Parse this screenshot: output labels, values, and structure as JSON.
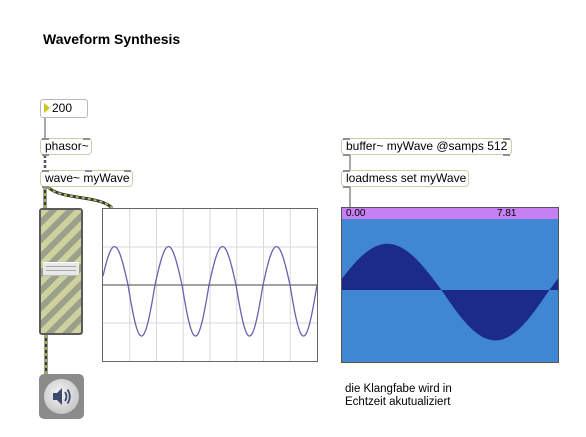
{
  "patch": {
    "title": "Waveform Synthesis",
    "number_box": {
      "value": "200"
    },
    "objects": {
      "phasor": "phasor~",
      "wave": "wave~ myWave",
      "buffer": "buffer~ myWave @samps 512",
      "loadmess": "loadmess set myWave"
    },
    "gain_slider": {
      "level": 0.55
    },
    "speaker": {
      "icon": "speaker-icon"
    },
    "waveform_display": {
      "ruler_start": "0.00",
      "ruler_end": "7.81",
      "ruler_color": "#c680f1",
      "background_color": "#3f86d3",
      "wave_color": "#1c2a8a"
    },
    "scope": {
      "line_color": "#6e5fb0"
    },
    "comment": {
      "line1": "die Klangfabe wird in",
      "line2": "Echtzeit akutualiziert"
    },
    "colors": {
      "object_border": "#c6d1ab",
      "patch_cord": "#3a3a3a",
      "signal_cord": "#c8d24a"
    }
  }
}
